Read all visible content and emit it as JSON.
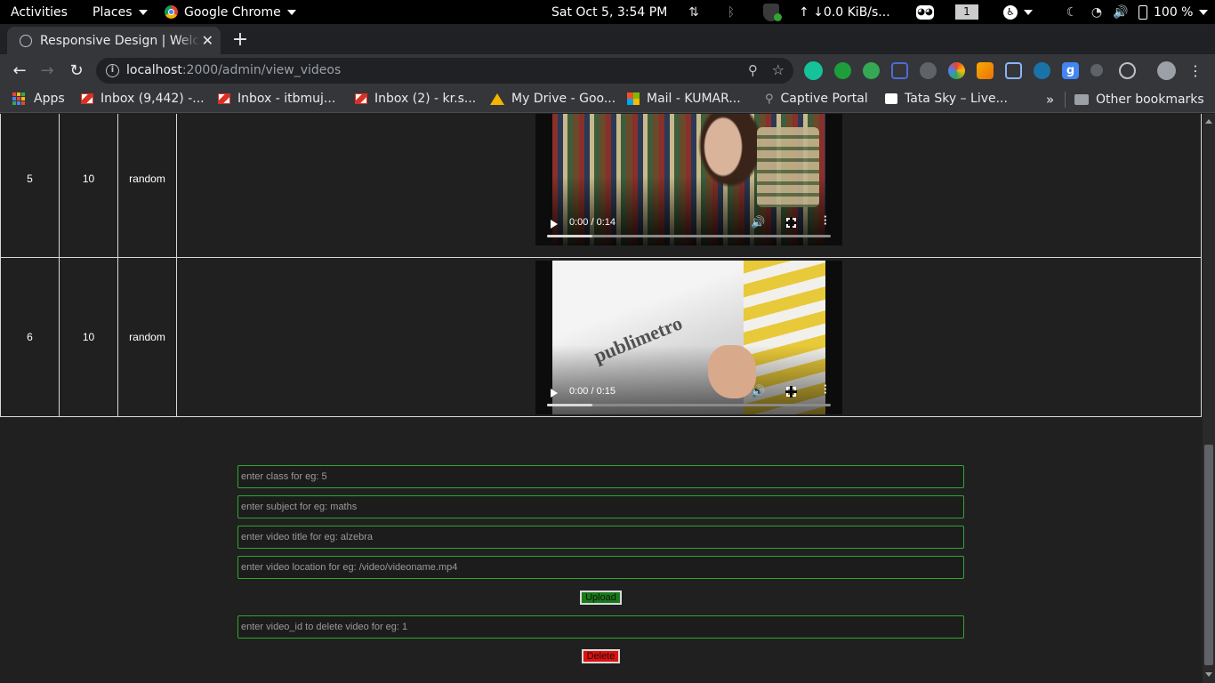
{
  "topbar": {
    "activities": "Activities",
    "places": "Places",
    "app_name": "Google Chrome",
    "clock": "Sat Oct  5,  3:54 PM",
    "network_speed": "↑ ↓0.0 KiB/s...",
    "workspace": "1",
    "battery": "100 %"
  },
  "browser": {
    "tab_title": "Responsive Design | Welcome",
    "url_host": "localhost",
    "url_path": ":2000/admin/view_videos",
    "bookmarks": [
      "Apps",
      "Inbox (9,442) -...",
      "Inbox - itbmuj...",
      "Inbox (2) - kr.s...",
      "My Drive - Goo...",
      "Mail - KUMAR...",
      "Captive Portal",
      "Tata Sky – Live...",
      "Other bookmarks"
    ]
  },
  "videos": {
    "rows": [
      {
        "id": "5",
        "class": "10",
        "subject": "random",
        "time": "0:00 / 0:14",
        "progress": 0.16,
        "thumb": "library"
      },
      {
        "id": "6",
        "class": "10",
        "subject": "random",
        "time": "0:00 / 0:15",
        "progress": 0.16,
        "thumb": "newspaper"
      }
    ],
    "frame2_text": "publimetro"
  },
  "form": {
    "class_placeholder": "enter class for eg: 5",
    "subject_placeholder": "enter subject for eg: maths",
    "title_placeholder": "enter video title for eg: alzebra",
    "location_placeholder": "enter video location for eg: /video/videoname.mp4",
    "upload_label": "Upload",
    "delete_placeholder": "enter video_id to delete video for eg: 1",
    "delete_label": "Delete"
  },
  "colors": {
    "page_bg": "#202020",
    "input_border": "#2fa62f",
    "upload_bg": "#1a7a1a",
    "delete_bg": "#e01010"
  }
}
